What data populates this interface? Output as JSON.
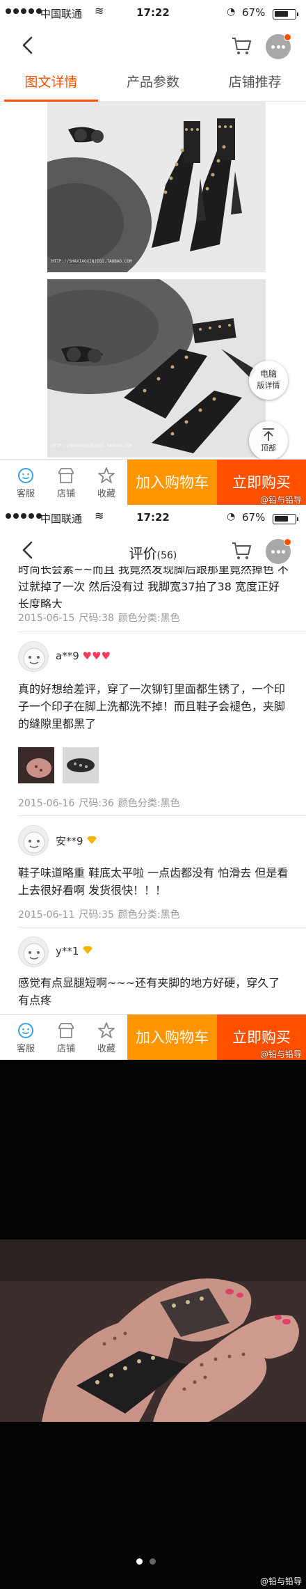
{
  "status_bar": {
    "carrier": "中国联通",
    "time": "17:22",
    "battery": "67%",
    "battery_level": 0.67
  },
  "product_page": {
    "tabs": [
      {
        "label": "图文详情",
        "active": true
      },
      {
        "label": "产品参数",
        "active": false
      },
      {
        "label": "店铺推荐",
        "active": false
      }
    ],
    "watermark": "HTTP://SHAXIAOXINJIQI.TAOBAO.COM",
    "desktop_button": [
      "电脑",
      "版详情"
    ],
    "top_button": "顶部"
  },
  "action_bar": {
    "service": "客服",
    "shop": "店铺",
    "favorite": "收藏",
    "add_to_cart": "加入购物车",
    "buy_now": "立即购买"
  },
  "credit": "@铅与铅导",
  "reviews_page": {
    "title": "评价",
    "count": "(56)",
    "reviews": [
      {
        "text": "时尚长会素~~而且 我竟然发现脚后跟那里竟然掉色 不过就掉了一次 然后没有过 我脚宽37拍了38 宽度正好 长度略大",
        "date": "2015-06-15",
        "size": "尺码:38",
        "color": "颜色分类:黑色"
      },
      {
        "user": "a**9",
        "hearts": 3,
        "text": "真的好想给差评，穿了一次铆钉里面都生锈了，一个印子一个印子在脚上洗都洗不掉！而且鞋子会褪色，夹脚的缝隙里都黑了",
        "date": "2015-06-16",
        "size": "尺码:36",
        "color": "颜色分类:黑色"
      },
      {
        "user": "安**9",
        "badge": "gold-diamond",
        "text": "鞋子味道略重 鞋底太平啦 一点齿都没有 怕滑去 但是看上去很好看啊 发货很快！！！",
        "date": "2015-06-11",
        "size": "尺码:35",
        "color": "颜色分类:黑色"
      },
      {
        "user": "y**1",
        "badge": "gold-diamond",
        "text": "感觉有点显腿短啊~~~还有夹脚的地方好硬，穿久了有点疼"
      }
    ]
  },
  "colors": {
    "brand_orange": "#ff5000",
    "cart_orange": "#ff9500",
    "heart_red": "#ff3b5c",
    "diamond_gold": "#f5b400"
  }
}
